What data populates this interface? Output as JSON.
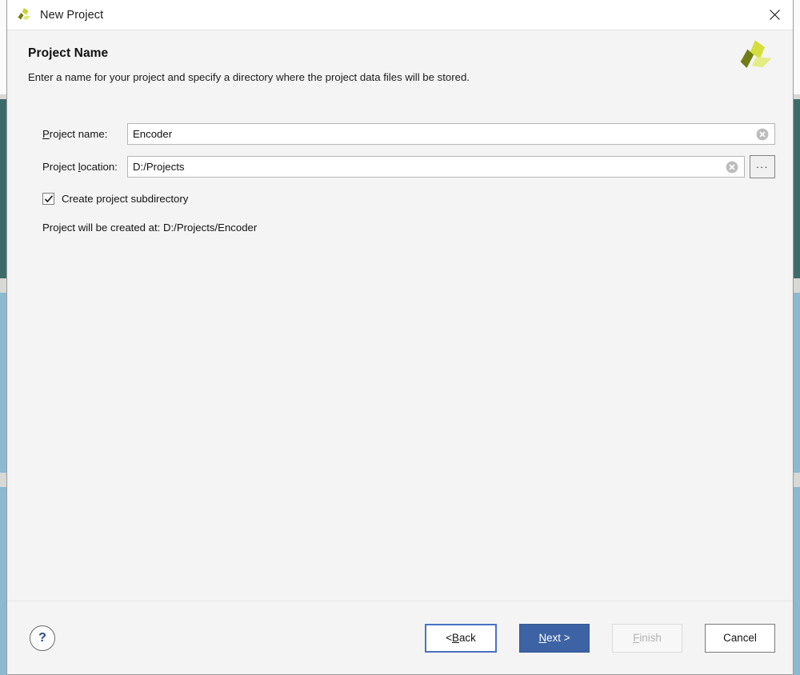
{
  "window": {
    "title": "New Project",
    "logo_icon": "vivado-pinwheel-icon",
    "close_icon": "close-icon"
  },
  "header": {
    "title": "Project Name",
    "subtitle": "Enter a name for your project and specify a directory where the project data files will be stored.",
    "logo_icon": "vivado-pinwheel-logo"
  },
  "form": {
    "project_name": {
      "label_prefix": "",
      "label_mnemonic": "P",
      "label_suffix": "roject name:",
      "label_full": "Project name:",
      "value": "Encoder",
      "placeholder": "",
      "clear_icon": "clear-circle-icon"
    },
    "project_location": {
      "label_prefix": "Project ",
      "label_mnemonic": "l",
      "label_suffix": "ocation:",
      "label_full": "Project location:",
      "value": "D:/Projects",
      "placeholder": "",
      "clear_icon": "clear-circle-icon",
      "browse_label": "...",
      "browse_icon": "ellipsis-icon"
    },
    "create_subdirectory": {
      "label": "Create project subdirectory",
      "checked": true,
      "check_icon": "checkmark-icon"
    },
    "created_at_text": "Project will be created at: D:/Projects/Encoder"
  },
  "footer": {
    "help_label": "?",
    "help_icon": "question-mark-icon",
    "buttons": [
      {
        "label_prefix": "< ",
        "label_mnemonic": "B",
        "label_suffix": "ack",
        "label_full": "< Back",
        "state": "focused"
      },
      {
        "label_prefix": "",
        "label_mnemonic": "N",
        "label_suffix": "ext >",
        "label_full": "Next >",
        "state": "default"
      },
      {
        "label_prefix": "",
        "label_mnemonic": "F",
        "label_suffix": "inish",
        "label_full": "Finish",
        "state": "disabled"
      },
      {
        "label_prefix": "Cancel",
        "label_mnemonic": "",
        "label_suffix": "",
        "label_full": "Cancel",
        "state": "normal"
      }
    ]
  },
  "colors": {
    "accent_blue": "#3d63a5",
    "focus_blue": "#4a72c0",
    "backdrop_teal": "#3d6b6a",
    "backdrop_blue": "#8cb8d0",
    "dialog_bg": "#f4f4f4",
    "logo_dark": "#6f7d14",
    "logo_bright": "#d4de3c",
    "logo_pale": "#e4ec86"
  }
}
